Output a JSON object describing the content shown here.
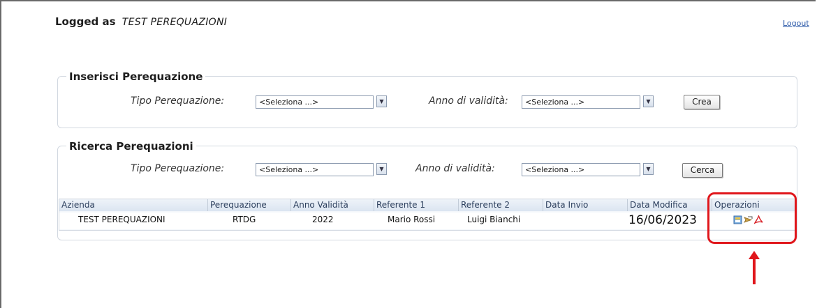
{
  "header": {
    "logged_label": "Logged as",
    "user_name": "TEST PEREQUAZIONI",
    "logout_label": "Logout"
  },
  "insert_panel": {
    "title": "Inserisci Perequazione",
    "tipo_label": "Tipo Perequazione:",
    "tipo_value": "<Seleziona ...>",
    "anno_label": "Anno di validità:",
    "anno_value": "<Seleziona ...>",
    "button_label": "Crea"
  },
  "search_panel": {
    "title": "Ricerca Perequazioni",
    "tipo_label": "Tipo Perequazione:",
    "tipo_value": "<Seleziona ...>",
    "anno_label": "Anno di validità:",
    "anno_value": "<Seleziona ...>",
    "button_label": "Cerca"
  },
  "table": {
    "columns": [
      "Azienda",
      "Perequazione",
      "Anno Validità",
      "Referente 1",
      "Referente 2",
      "Data Invio",
      "Data Modifica",
      "Operazioni"
    ],
    "rows": [
      {
        "azienda": "TEST PEREQUAZIONI",
        "perequazione": "RTDG",
        "anno_validita": "2022",
        "referente_1": "Mario Rossi",
        "referente_2": "Luigi Bianchi",
        "data_invio": "",
        "data_modifica": "16/06/2023",
        "operazioni": [
          "edit-icon",
          "send-icon",
          "pdf-icon"
        ]
      }
    ]
  },
  "colors": {
    "highlight": "#e0161b",
    "link": "#2a58a8",
    "grid_header": "#dbe5f1"
  },
  "annotation": {
    "type": "red-box-and-arrow",
    "target": "operazioni"
  }
}
